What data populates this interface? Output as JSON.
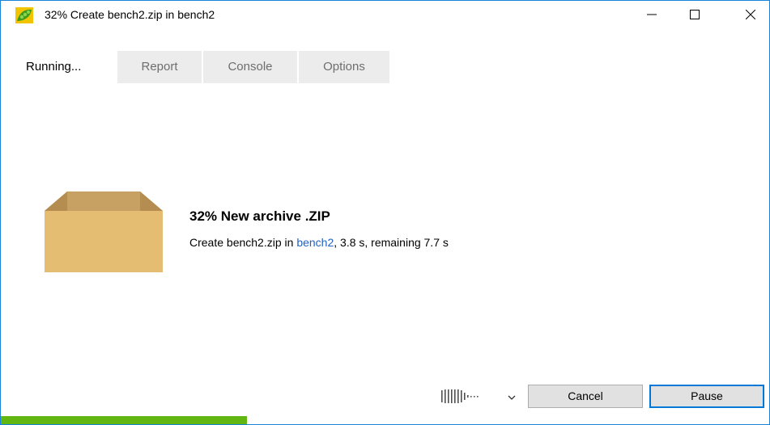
{
  "window": {
    "title": "32% Create bench2.zip in bench2"
  },
  "tabs": [
    {
      "label": "Running...",
      "active": true
    },
    {
      "label": "Report",
      "active": false
    },
    {
      "label": "Console",
      "active": false
    },
    {
      "label": "Options",
      "active": false
    }
  ],
  "operation": {
    "title": "32% New archive .ZIP",
    "detail_prefix": "Create bench2.zip in ",
    "detail_link": "bench2",
    "detail_suffix": ", 3.8 s, remaining 7.7 s"
  },
  "buttons": {
    "cancel": "Cancel",
    "pause": "Pause"
  },
  "progress": {
    "percent": 32,
    "color": "#62b612"
  },
  "icons": {
    "app": "pea-pod-icon",
    "minimize": "minimize-icon",
    "maximize": "maximize-icon",
    "close": "close-icon",
    "archive": "open-box-icon",
    "speed": "speed-bars-icon",
    "chevron": "chevron-down-icon"
  },
  "colors": {
    "accent": "#0078d7",
    "link": "#1f62c4"
  }
}
